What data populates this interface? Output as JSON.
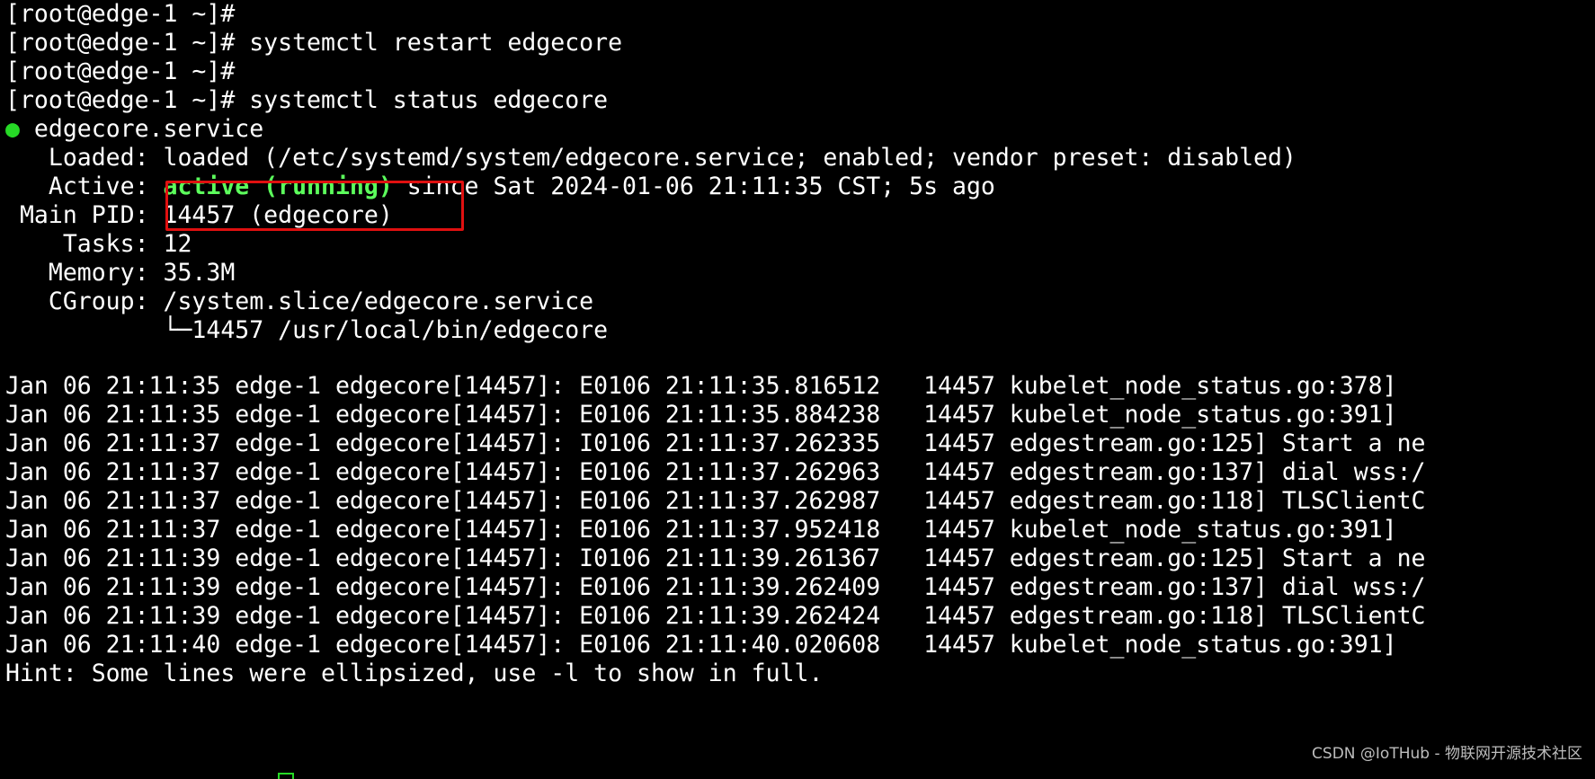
{
  "terminal": {
    "prompt_lines": [
      "[root@edge-1 ~]#",
      "[root@edge-1 ~]# systemctl restart edgecore",
      "[root@edge-1 ~]#",
      "[root@edge-1 ~]# systemctl status edgecore"
    ],
    "service": {
      "bullet": "●",
      "name": " edgecore.service",
      "loaded": "   Loaded: loaded (/etc/systemd/system/edgecore.service; enabled; vendor preset: disabled)",
      "active_label": "   Active: ",
      "active_state": "active (running)",
      "active_rest": " since Sat 2024-01-06 21:11:35 CST; 5s ago",
      "main_pid": " Main PID: 14457 (edgecore)",
      "tasks": "    Tasks: 12",
      "memory": "   Memory: 35.3M",
      "cgroup": "   CGroup: /system.slice/edgecore.service",
      "cgroup_child": "           └─14457 /usr/local/bin/edgecore"
    },
    "log_lines": [
      "Jan 06 21:11:35 edge-1 edgecore[14457]: E0106 21:11:35.816512   14457 kubelet_node_status.go:378]",
      "Jan 06 21:11:35 edge-1 edgecore[14457]: E0106 21:11:35.884238   14457 kubelet_node_status.go:391]",
      "Jan 06 21:11:37 edge-1 edgecore[14457]: I0106 21:11:37.262335   14457 edgestream.go:125] Start a ne",
      "Jan 06 21:11:37 edge-1 edgecore[14457]: E0106 21:11:37.262963   14457 edgestream.go:137] dial wss:/",
      "Jan 06 21:11:37 edge-1 edgecore[14457]: E0106 21:11:37.262987   14457 edgestream.go:118] TLSClientC",
      "Jan 06 21:11:37 edge-1 edgecore[14457]: E0106 21:11:37.952418   14457 kubelet_node_status.go:391]",
      "Jan 06 21:11:39 edge-1 edgecore[14457]: I0106 21:11:39.261367   14457 edgestream.go:125] Start a ne",
      "Jan 06 21:11:39 edge-1 edgecore[14457]: E0106 21:11:39.262409   14457 edgestream.go:137] dial wss:/",
      "Jan 06 21:11:39 edge-1 edgecore[14457]: E0106 21:11:39.262424   14457 edgestream.go:118] TLSClientC",
      "Jan 06 21:11:40 edge-1 edgecore[14457]: E0106 21:11:40.020608   14457 kubelet_node_status.go:391]"
    ],
    "hint": "Hint: Some lines were ellipsized, use -l to show in full."
  },
  "watermark": "CSDN @IoTHub - 物联网开源技术社区",
  "colors": {
    "background": "#000000",
    "text": "#ffffff",
    "active_green": "#5cff5c",
    "bullet_green": "#26d926",
    "highlight_red": "#e01010"
  }
}
